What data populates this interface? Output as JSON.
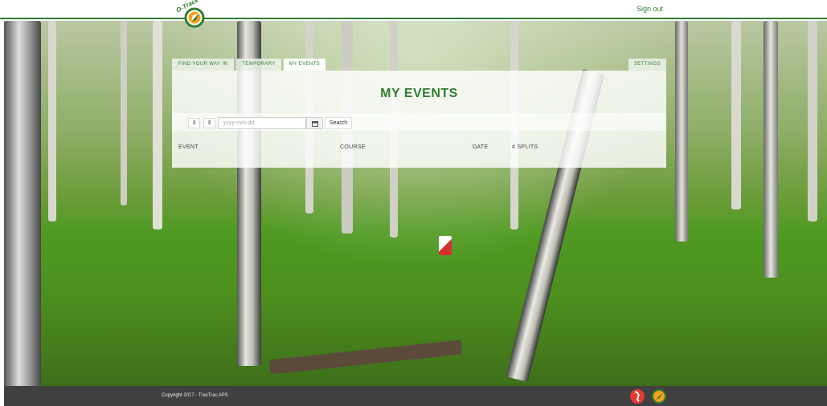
{
  "header": {
    "logo_text": "O-Track",
    "signout_label": "Sign out"
  },
  "tabs": [
    {
      "label": "FIND YOUR WAY IN"
    },
    {
      "label": "TEMPORARY"
    },
    {
      "label": "MY EVENTS",
      "active": true
    },
    {
      "label": "SETTINGS"
    }
  ],
  "panel": {
    "title": "MY EVENTS"
  },
  "search": {
    "date_placeholder": "yyyy-mm-dd",
    "search_label": "Search",
    "spin_icon": "⇕",
    "calendar_icon": "calendar-icon"
  },
  "table": {
    "columns": [
      "EVENT",
      "COURSE",
      "DATE",
      "# SPLITS"
    ]
  },
  "footer": {
    "copyright": "Copyright 2017 - TracTrac APS"
  },
  "colors": {
    "brand_green": "#2e7d32",
    "accent_orange": "#f4a11a",
    "footer_red": "#e53935"
  }
}
